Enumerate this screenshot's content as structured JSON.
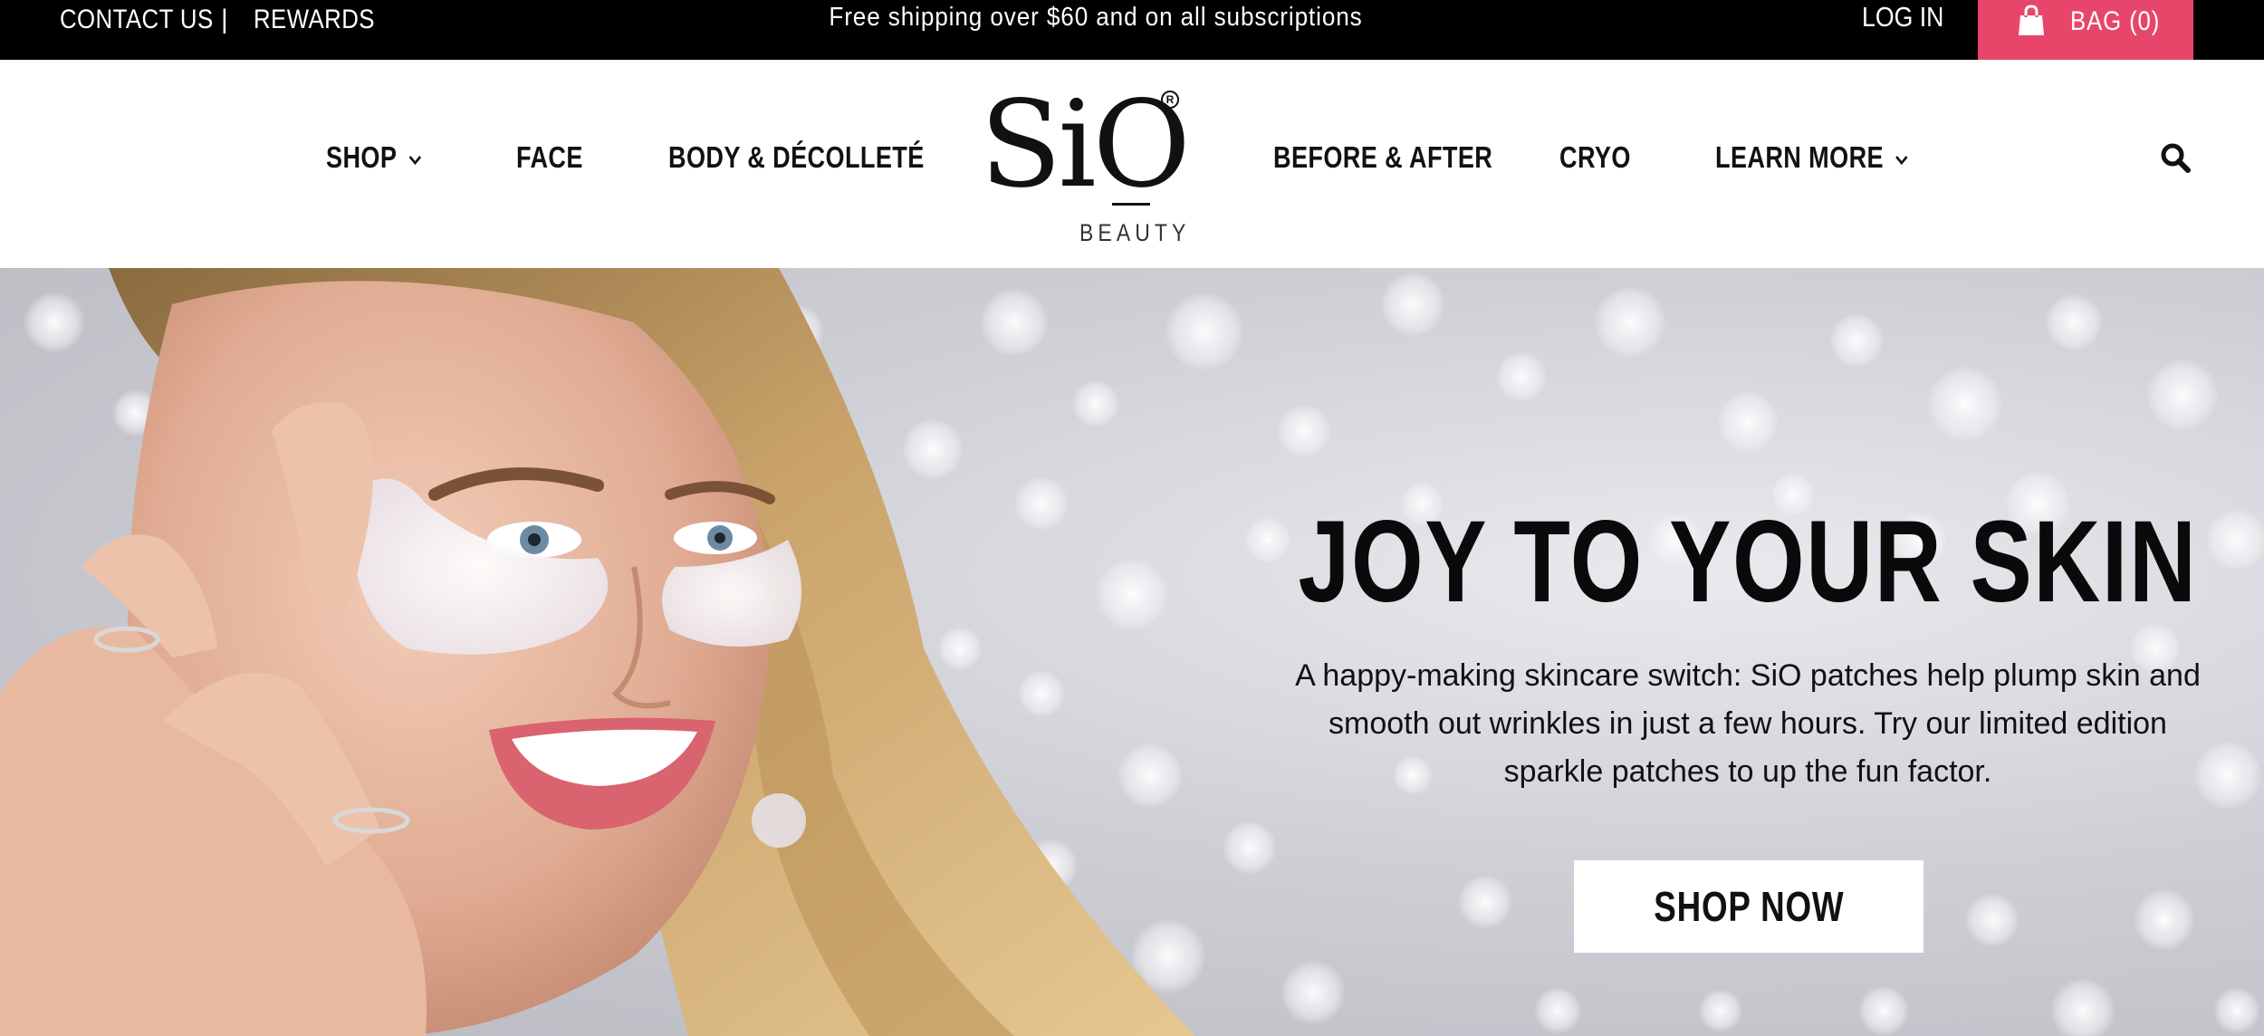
{
  "topbar": {
    "contact_label": "CONTACT US",
    "separator": "|",
    "rewards_label": "REWARDS",
    "promo_text": "Free shipping over $60 and on all subscriptions",
    "login_label": "LOG IN",
    "bag_label": "BAG (0)",
    "bag_icon": "shopping-bag-icon",
    "background": "#000000",
    "bag_color": "#e8456b"
  },
  "nav": {
    "left_items": [
      {
        "label": "SHOP",
        "has_dropdown": true
      },
      {
        "label": "FACE",
        "has_dropdown": false
      },
      {
        "label": "BODY & DÉCOLLETÉ",
        "has_dropdown": false
      }
    ],
    "right_items": [
      {
        "label": "BEFORE & AFTER",
        "has_dropdown": false
      },
      {
        "label": "CRYO",
        "has_dropdown": false
      },
      {
        "label": "LEARN MORE",
        "has_dropdown": true
      }
    ],
    "logo_text": "SiO",
    "logo_subtext": "BEAUTY",
    "search_icon": "search-icon"
  },
  "hero": {
    "title": "JOY TO YOUR SKIN",
    "body": "A happy-making skincare switch: SiO patches help plump skin and smooth out wrinkles in just a few hours. Try our limited edition sparkle patches to up the fun factor.",
    "cta_label": "SHOP NOW",
    "cta_background": "#ffffff"
  }
}
